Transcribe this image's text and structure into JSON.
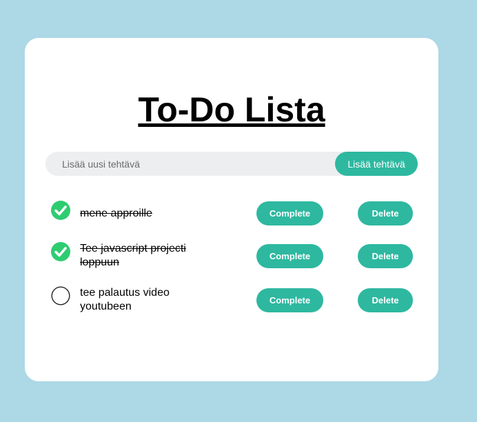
{
  "app": {
    "title": "To-Do Lista"
  },
  "add_task": {
    "placeholder": "Lisää uusi tehtävä",
    "button_label": "Lisää tehtävä"
  },
  "tasks": [
    {
      "text": "mene approille",
      "completed": true,
      "complete_label": "Complete",
      "delete_label": "Delete"
    },
    {
      "text": "Tee javascript projecti loppuun",
      "completed": true,
      "complete_label": "Complete",
      "delete_label": "Delete"
    },
    {
      "text": "tee palautus video youtubeen",
      "completed": false,
      "complete_label": "Complete",
      "delete_label": "Delete"
    }
  ],
  "icons": {
    "completed": "check-circle-icon",
    "pending": "empty-circle-icon"
  },
  "colors": {
    "page_background": "#add8e6",
    "card_background": "#ffffff",
    "accent": "#2eb8a0",
    "check_green": "#2ecc71",
    "input_background": "#edeef0"
  }
}
